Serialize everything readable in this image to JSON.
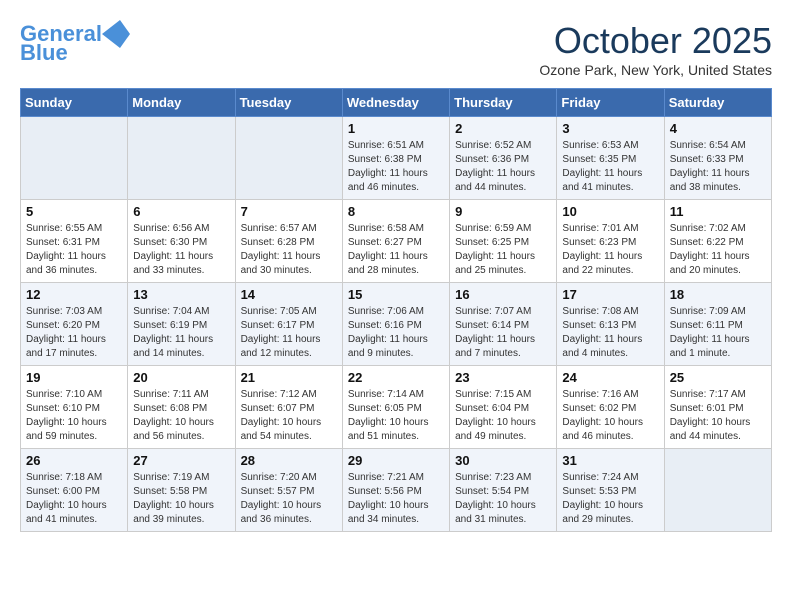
{
  "header": {
    "logo_line1": "General",
    "logo_line2": "Blue",
    "month": "October 2025",
    "location": "Ozone Park, New York, United States"
  },
  "weekdays": [
    "Sunday",
    "Monday",
    "Tuesday",
    "Wednesday",
    "Thursday",
    "Friday",
    "Saturday"
  ],
  "weeks": [
    [
      {
        "day": "",
        "sunrise": "",
        "sunset": "",
        "daylight": ""
      },
      {
        "day": "",
        "sunrise": "",
        "sunset": "",
        "daylight": ""
      },
      {
        "day": "",
        "sunrise": "",
        "sunset": "",
        "daylight": ""
      },
      {
        "day": "1",
        "sunrise": "6:51 AM",
        "sunset": "6:38 PM",
        "daylight": "11 hours and 46 minutes."
      },
      {
        "day": "2",
        "sunrise": "6:52 AM",
        "sunset": "6:36 PM",
        "daylight": "11 hours and 44 minutes."
      },
      {
        "day": "3",
        "sunrise": "6:53 AM",
        "sunset": "6:35 PM",
        "daylight": "11 hours and 41 minutes."
      },
      {
        "day": "4",
        "sunrise": "6:54 AM",
        "sunset": "6:33 PM",
        "daylight": "11 hours and 38 minutes."
      }
    ],
    [
      {
        "day": "5",
        "sunrise": "6:55 AM",
        "sunset": "6:31 PM",
        "daylight": "11 hours and 36 minutes."
      },
      {
        "day": "6",
        "sunrise": "6:56 AM",
        "sunset": "6:30 PM",
        "daylight": "11 hours and 33 minutes."
      },
      {
        "day": "7",
        "sunrise": "6:57 AM",
        "sunset": "6:28 PM",
        "daylight": "11 hours and 30 minutes."
      },
      {
        "day": "8",
        "sunrise": "6:58 AM",
        "sunset": "6:27 PM",
        "daylight": "11 hours and 28 minutes."
      },
      {
        "day": "9",
        "sunrise": "6:59 AM",
        "sunset": "6:25 PM",
        "daylight": "11 hours and 25 minutes."
      },
      {
        "day": "10",
        "sunrise": "7:01 AM",
        "sunset": "6:23 PM",
        "daylight": "11 hours and 22 minutes."
      },
      {
        "day": "11",
        "sunrise": "7:02 AM",
        "sunset": "6:22 PM",
        "daylight": "11 hours and 20 minutes."
      }
    ],
    [
      {
        "day": "12",
        "sunrise": "7:03 AM",
        "sunset": "6:20 PM",
        "daylight": "11 hours and 17 minutes."
      },
      {
        "day": "13",
        "sunrise": "7:04 AM",
        "sunset": "6:19 PM",
        "daylight": "11 hours and 14 minutes."
      },
      {
        "day": "14",
        "sunrise": "7:05 AM",
        "sunset": "6:17 PM",
        "daylight": "11 hours and 12 minutes."
      },
      {
        "day": "15",
        "sunrise": "7:06 AM",
        "sunset": "6:16 PM",
        "daylight": "11 hours and 9 minutes."
      },
      {
        "day": "16",
        "sunrise": "7:07 AM",
        "sunset": "6:14 PM",
        "daylight": "11 hours and 7 minutes."
      },
      {
        "day": "17",
        "sunrise": "7:08 AM",
        "sunset": "6:13 PM",
        "daylight": "11 hours and 4 minutes."
      },
      {
        "day": "18",
        "sunrise": "7:09 AM",
        "sunset": "6:11 PM",
        "daylight": "11 hours and 1 minute."
      }
    ],
    [
      {
        "day": "19",
        "sunrise": "7:10 AM",
        "sunset": "6:10 PM",
        "daylight": "10 hours and 59 minutes."
      },
      {
        "day": "20",
        "sunrise": "7:11 AM",
        "sunset": "6:08 PM",
        "daylight": "10 hours and 56 minutes."
      },
      {
        "day": "21",
        "sunrise": "7:12 AM",
        "sunset": "6:07 PM",
        "daylight": "10 hours and 54 minutes."
      },
      {
        "day": "22",
        "sunrise": "7:14 AM",
        "sunset": "6:05 PM",
        "daylight": "10 hours and 51 minutes."
      },
      {
        "day": "23",
        "sunrise": "7:15 AM",
        "sunset": "6:04 PM",
        "daylight": "10 hours and 49 minutes."
      },
      {
        "day": "24",
        "sunrise": "7:16 AM",
        "sunset": "6:02 PM",
        "daylight": "10 hours and 46 minutes."
      },
      {
        "day": "25",
        "sunrise": "7:17 AM",
        "sunset": "6:01 PM",
        "daylight": "10 hours and 44 minutes."
      }
    ],
    [
      {
        "day": "26",
        "sunrise": "7:18 AM",
        "sunset": "6:00 PM",
        "daylight": "10 hours and 41 minutes."
      },
      {
        "day": "27",
        "sunrise": "7:19 AM",
        "sunset": "5:58 PM",
        "daylight": "10 hours and 39 minutes."
      },
      {
        "day": "28",
        "sunrise": "7:20 AM",
        "sunset": "5:57 PM",
        "daylight": "10 hours and 36 minutes."
      },
      {
        "day": "29",
        "sunrise": "7:21 AM",
        "sunset": "5:56 PM",
        "daylight": "10 hours and 34 minutes."
      },
      {
        "day": "30",
        "sunrise": "7:23 AM",
        "sunset": "5:54 PM",
        "daylight": "10 hours and 31 minutes."
      },
      {
        "day": "31",
        "sunrise": "7:24 AM",
        "sunset": "5:53 PM",
        "daylight": "10 hours and 29 minutes."
      },
      {
        "day": "",
        "sunrise": "",
        "sunset": "",
        "daylight": ""
      }
    ]
  ]
}
